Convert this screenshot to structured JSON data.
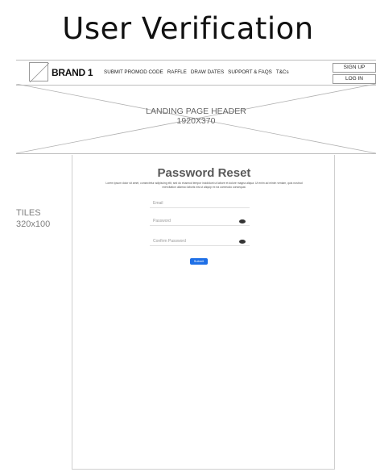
{
  "slide": {
    "title": "User Verification"
  },
  "navbar": {
    "brand": "BRAND 1",
    "links": [
      "SUBMIT PROMOD CODE",
      "RAFFLE",
      "DRAW DATES",
      "SUPPORT & FAQS",
      "T&Cs"
    ],
    "signup": "SIGN UP",
    "login": "LOG  IN"
  },
  "header_placeholder": {
    "label": "LANDING PAGE HEADER",
    "size": "1920X370"
  },
  "tiles": {
    "label": "TILES",
    "size": "320x100"
  },
  "form": {
    "title": "Password Reset",
    "description": "Lorem ipsum dolor sit amet, consectetur adipiscing elit, sed do eiusmod tempor incididunt ut labore et dolore magna aliqua. Ut enim ad minim veniam, quis nostrud exercitation ullamco laboris nisi ut aliquip ex ea commodo consequat.",
    "email_placeholder": "Email",
    "password_placeholder": "Password",
    "confirm_placeholder": "Confirm Password",
    "submit_label": "Submit"
  }
}
